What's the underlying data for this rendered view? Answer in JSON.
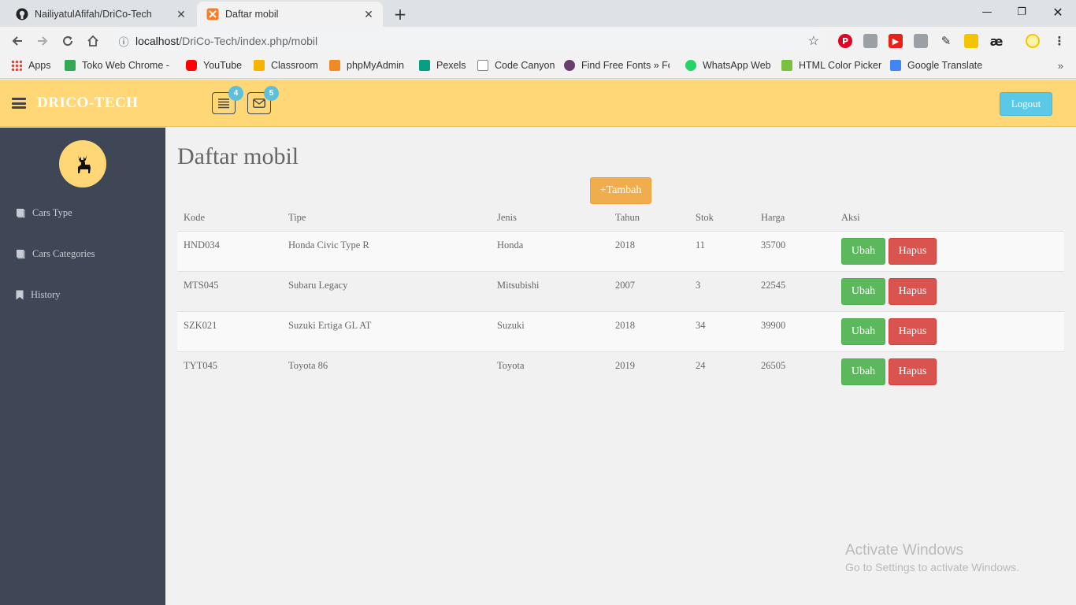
{
  "browser": {
    "tabs": [
      {
        "title": "NailiyatulAfifah/DriCo-Tech",
        "close": "✕"
      },
      {
        "title": "Daftar mobil",
        "close": "✕"
      }
    ],
    "new_tab": "+",
    "window_controls": {
      "minimize": "—",
      "restore": "❐",
      "close": "✕"
    },
    "url_host": "localhost",
    "url_path": "/DriCo-Tech/index.php/mobil",
    "bookmarks": [
      {
        "label": "Apps",
        "color": "#e94235"
      },
      {
        "label": "Toko Web Chrome - c",
        "color": "#34a853"
      },
      {
        "label": "YouTube",
        "color": "#ff0000"
      },
      {
        "label": "Classroom",
        "color": "#f4b400"
      },
      {
        "label": "phpMyAdmin",
        "color": "#f08a24"
      },
      {
        "label": "Pexels",
        "color": "#05a081"
      },
      {
        "label": "Code Canyon",
        "color": "#888888"
      },
      {
        "label": "Find Free Fonts » Fon",
        "color": "#6b3e6e"
      },
      {
        "label": "WhatsApp Web",
        "color": "#25d366"
      },
      {
        "label": "HTML Color Picker",
        "color": "#7ac142"
      },
      {
        "label": "Google Translate",
        "color": "#4285f4"
      }
    ],
    "bookmarks_more": "»"
  },
  "app": {
    "brand": "DRICO-TECH",
    "notif_count_list": "4",
    "notif_count_mail": "5",
    "logout_label": "Logout",
    "colors": {
      "accent": "#ffd777",
      "sidebar": "#3f4656",
      "success": "#5cb85c",
      "danger": "#d9534f",
      "warning": "#f0ad4e",
      "info": "#5bc8e6"
    }
  },
  "sidebar": {
    "items": [
      {
        "label": "Cars Type",
        "icon": "book-icon"
      },
      {
        "label": "Cars Categories",
        "icon": "book-icon"
      },
      {
        "label": "History",
        "icon": "bookmark-icon"
      }
    ]
  },
  "main": {
    "title": "Daftar mobil",
    "add_label": "+Tambah",
    "table": {
      "headers": [
        "Kode",
        "Tipe",
        "Jenis",
        "Tahun",
        "Stok",
        "Harga",
        "Aksi"
      ],
      "rows": [
        {
          "kode": "HND034",
          "tipe": "Honda Civic Type R",
          "jenis": "Honda",
          "tahun": "2018",
          "stok": "11",
          "harga": "35700"
        },
        {
          "kode": "MTS045",
          "tipe": "Subaru Legacy",
          "jenis": "Mitsubishi",
          "tahun": "2007",
          "stok": "3",
          "harga": "22545"
        },
        {
          "kode": "SZK021",
          "tipe": "Suzuki Ertiga GL AT",
          "jenis": "Suzuki",
          "tahun": "2018",
          "stok": "34",
          "harga": "39900"
        },
        {
          "kode": "TYT045",
          "tipe": "Toyota 86",
          "jenis": "Toyota",
          "tahun": "2019",
          "stok": "24",
          "harga": "26505"
        }
      ],
      "edit_label": "Ubah",
      "delete_label": "Hapus"
    }
  },
  "watermark": {
    "line1": "Activate Windows",
    "line2": "Go to Settings to activate Windows."
  }
}
